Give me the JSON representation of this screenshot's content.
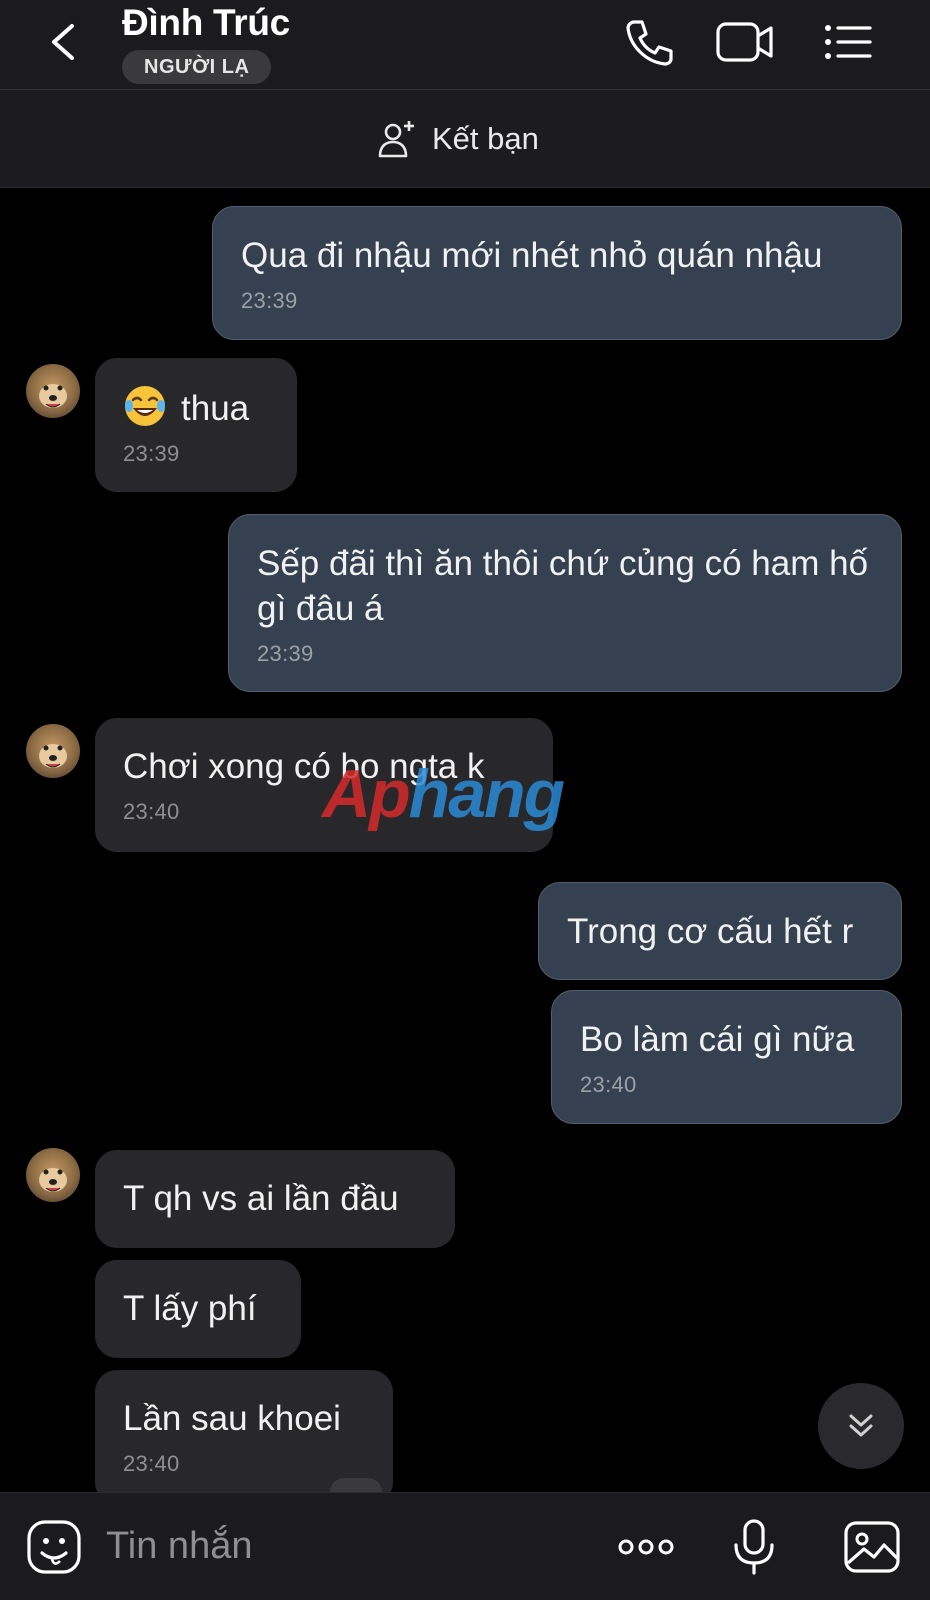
{
  "header": {
    "contact_name": "Đình Trúc",
    "badge": "NGƯỜI LẠ",
    "icons": [
      "back-chevron-icon",
      "phone-icon",
      "video-icon",
      "list-menu-icon"
    ]
  },
  "friend_bar": {
    "label": "Kết bạn",
    "icon": "add-friend-icon"
  },
  "messages": [
    {
      "direction": "out",
      "text": "Qua đi nhậu mới nhét nhỏ quán nhậu",
      "time": "23:39"
    },
    {
      "direction": "in",
      "emoji": "😂",
      "text": "thua",
      "time": "23:39"
    },
    {
      "direction": "out",
      "text": "Sếp đãi thì ăn thôi chứ củng có ham hố gì đâu á",
      "time": "23:39"
    },
    {
      "direction": "in",
      "text": "Chơi xong có bo ngta k",
      "time": "23:40"
    },
    {
      "direction": "out",
      "text": "Trong cơ cấu hết r",
      "time": ""
    },
    {
      "direction": "out",
      "text": "Bo làm cái gì nữa",
      "time": "23:40"
    },
    {
      "direction": "in",
      "text": "T qh vs ai lần đầu",
      "time": ""
    },
    {
      "direction": "in",
      "text": "T lấy phí",
      "time": ""
    },
    {
      "direction": "in",
      "text": "Lần sau khoei",
      "time": "23:40"
    }
  ],
  "watermark": {
    "part1": "Ap",
    "part2": "hang"
  },
  "composer": {
    "placeholder": "Tin nhắn",
    "icons": [
      "sticker-icon",
      "more-options-icon",
      "microphone-icon",
      "image-icon"
    ]
  },
  "colors": {
    "outgoing_bubble": "#354050",
    "incoming_bubble": "#28282a",
    "background": "#000000"
  }
}
